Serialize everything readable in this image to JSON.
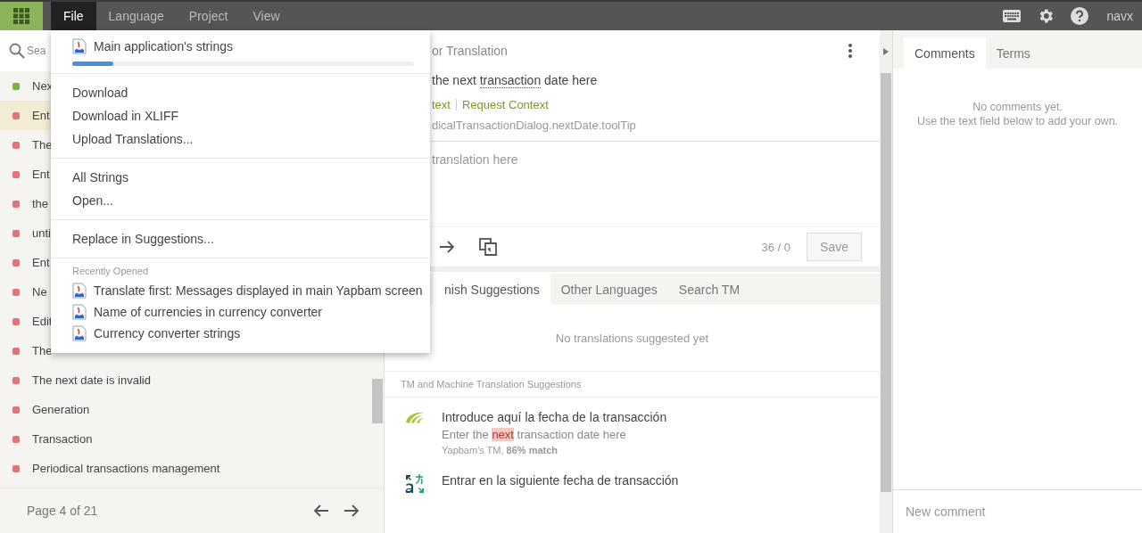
{
  "top_bar": {
    "menus": [
      {
        "label": "File",
        "selected": true
      },
      {
        "label": "Language",
        "selected": false
      },
      {
        "label": "Project",
        "selected": false
      },
      {
        "label": "View",
        "selected": false
      }
    ],
    "user": "navx"
  },
  "file_menu": {
    "current_file": {
      "name": "Main application's strings",
      "level": 0.12
    },
    "groups": [
      [
        "Download",
        "Download in XLIFF",
        "Upload Translations..."
      ],
      [
        "All Strings",
        "Open..."
      ],
      [
        "Replace in Suggestions..."
      ]
    ],
    "recent_heading": "Recently Opened",
    "recent": [
      "Translate first: Messages displayed in main Yapbam screen",
      "Name of currencies in currency converter",
      "Currency converter strings"
    ]
  },
  "string_list": {
    "search_placeholder": "Sea",
    "items": [
      {
        "text": "Nex",
        "color": "#7cb342",
        "selected": false
      },
      {
        "text": "Ent",
        "color": "#e57373",
        "selected": true
      },
      {
        "text": "The",
        "color": "#e57373",
        "selected": false
      },
      {
        "text": "Ent",
        "color": "#e57373",
        "selected": false
      },
      {
        "text": "the",
        "color": "#e57373",
        "selected": false
      },
      {
        "text": "unti",
        "color": "#e57373",
        "selected": false
      },
      {
        "text": "Ent",
        "color": "#e57373",
        "selected": false
      },
      {
        "text": "Ne",
        "color": "#e57373",
        "selected": false
      },
      {
        "text": "Edit",
        "color": "#e57373",
        "selected": false
      },
      {
        "text": "The",
        "color": "#e57373",
        "selected": false
      },
      {
        "text": "The next date is invalid",
        "color": "#e57373",
        "selected": false
      },
      {
        "text": "Generation",
        "color": "#e57373",
        "selected": false
      },
      {
        "text": "Transaction",
        "color": "#e57373",
        "selected": false
      },
      {
        "text": "Periodical transactions management",
        "color": "#e57373",
        "selected": false
      }
    ],
    "page": "Page 4 of 21"
  },
  "editor": {
    "title": "or Translation",
    "source": {
      "before": "the next ",
      "term": "transaction",
      "after": " date here"
    },
    "links": [
      "text",
      "Request Context"
    ],
    "key": "dicalTransactionDialog.nextDate.toolTip",
    "translation_placeholder": "translation here",
    "counter": "36 / 0",
    "save": "Save"
  },
  "suggestions": {
    "tabs": [
      {
        "label": "nish Suggestions",
        "selected": true
      },
      {
        "label": "Other Languages",
        "selected": false
      },
      {
        "label": "Search TM",
        "selected": false
      }
    ],
    "empty": "No translations suggested yet",
    "tm_heading": "TM and Machine Translation Suggestions",
    "items": [
      {
        "kind": "tm",
        "translation": "Introduce aquí la fecha de la transacción",
        "source_parts": [
          "Enter the ",
          "next",
          " transaction date here"
        ],
        "meta": "Yapbam's TM, **86% match**"
      },
      {
        "kind": "mt",
        "translation": "Entrar en la siguiente fecha de transacción"
      }
    ]
  },
  "side_panel": {
    "tabs": [
      {
        "label": "Comments",
        "selected": true
      },
      {
        "label": "Terms",
        "selected": false
      }
    ],
    "empty": [
      "No comments yet.",
      "Use the text field below to add your own."
    ],
    "comment_placeholder": "New comment"
  }
}
